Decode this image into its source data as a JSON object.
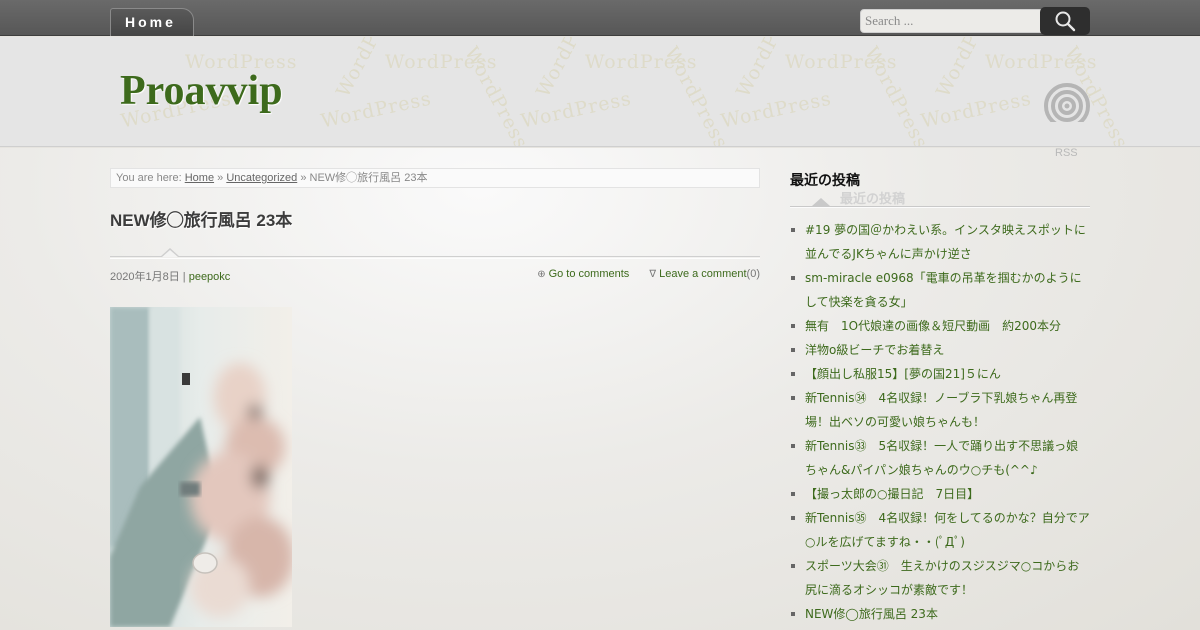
{
  "nav": {
    "home_label": "Home"
  },
  "search": {
    "placeholder": "Search ..."
  },
  "header": {
    "watermark": "WordPress",
    "site_title": "Proavvip",
    "rss_label": "RSS"
  },
  "breadcrumb": {
    "prefix": "You are here:",
    "home": "Home",
    "separator": "»",
    "category": "Uncategorized",
    "current": "NEW修◯旅行風呂 23本"
  },
  "post": {
    "title": "NEW修◯旅行風呂 23本",
    "date": "2020年1月8日",
    "meta_separator": "|",
    "author": "peepokc",
    "goto_comments": "Go to comments",
    "leave_comment": "Leave a comment",
    "comment_count": "(0)"
  },
  "sidebar": {
    "title": "最近の投稿",
    "ghost_title": "最近の投稿",
    "items": [
      "#19 夢の国＠かわえい系。インスタ映えスポットに並んでるJKちゃんに声かけ逆さ",
      "sm-miracle e0968「電車の吊革を掴むかのようにして快楽を貪る女」",
      "無有　1O代娘達の画像＆短尺動画　約200本分",
      "洋物o級ビーチでお着替え",
      "【顔出し私服15】[夢の国21]５にん",
      "新Tennis㉞　4名収録！ノーブラ下乳娘ちゃん再登場！出ベソの可愛い娘ちゃんも！",
      "新Tennis㉝　5名収録！一人で踊り出す不思議っ娘ちゃん&パイパン娘ちゃんのウ○チも(^^♪",
      "【撮っ太郎の○撮日記　7日目】",
      "新Tennis㉟　4名収録！何をしてるのかな？自分でア○ルを広げてますね・・(ﾟДﾟ)",
      "スポーツ大会㉛　生えかけのスジスジマ○コからお尻に滴るオシッコが素敵です！",
      "NEW修◯旅行風呂 23本"
    ]
  },
  "colors": {
    "accent": "#3d6a1c",
    "topbar": "#5f5f5f",
    "search_button": "#2e2e2e"
  }
}
